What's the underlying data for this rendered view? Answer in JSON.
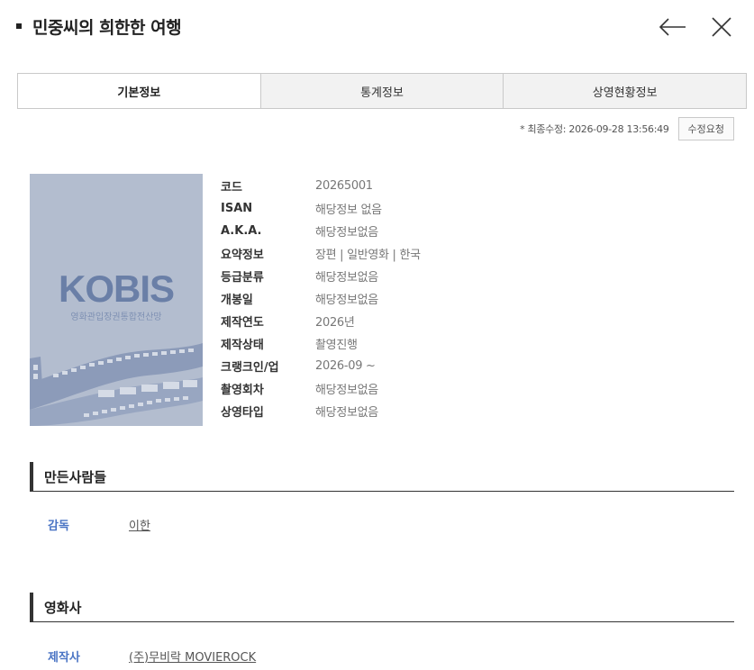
{
  "header": {
    "title": "민중씨의 희한한 여행"
  },
  "icons": {
    "back": "arrow-left-icon",
    "close": "close-icon"
  },
  "tabs": [
    {
      "label": "기본정보",
      "active": true
    },
    {
      "label": "통계정보",
      "active": false
    },
    {
      "label": "상영현황정보",
      "active": false
    }
  ],
  "meta": {
    "last_modified": "* 최종수정: 2026-09-28 13:56:49",
    "edit_request_label": "수정요청"
  },
  "poster": {
    "logo_text": "KOBIS",
    "logo_subtext": "영화관입장권통합전산망",
    "background_color": "#b3bdcf",
    "logo_color": "#6a7fa7"
  },
  "info": [
    {
      "label": "코드",
      "value": "20265001"
    },
    {
      "label": "ISAN",
      "value": "해당정보 없음"
    },
    {
      "label": "A.K.A.",
      "value": "해당정보없음"
    },
    {
      "label": "요약정보",
      "value": "장편 | 일반영화 | 한국"
    },
    {
      "label": "등급분류",
      "value": "해당정보없음"
    },
    {
      "label": "개봉일",
      "value": "해당정보없음"
    },
    {
      "label": "제작연도",
      "value": "2026년"
    },
    {
      "label": "제작상태",
      "value": "촬영진행"
    },
    {
      "label": "크랭크인/업",
      "value": "2026-09 ~"
    },
    {
      "label": "촬영회차",
      "value": "해당정보없음"
    },
    {
      "label": "상영타입",
      "value": "해당정보없음"
    }
  ],
  "sections": {
    "makers": {
      "title": "만든사람들",
      "rows": [
        {
          "role": "감독",
          "name": "이한"
        }
      ]
    },
    "companies": {
      "title": "영화사",
      "rows": [
        {
          "role": "제작사",
          "name": "(주)무비락 MOVIEROCK"
        }
      ]
    }
  },
  "colors": {
    "role_blue": "#4a74c4",
    "active_tab_bg": "#ffffff",
    "inactive_tab_bg": "#f2f2f2"
  }
}
